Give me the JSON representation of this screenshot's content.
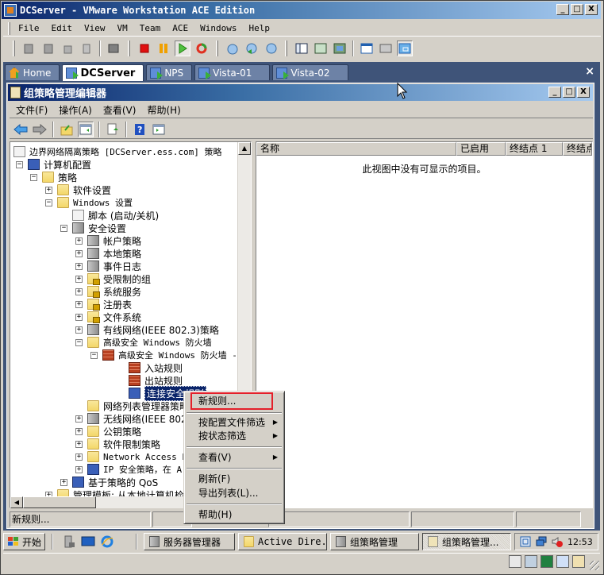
{
  "window": {
    "title": "DCServer - VMware Workstation ACE Edition",
    "controls": {
      "minimize": "_",
      "maximize": "□",
      "close": "X"
    }
  },
  "menubar": [
    "File",
    "Edit",
    "View",
    "VM",
    "Team",
    "ACE",
    "Windows",
    "Help"
  ],
  "toolbar_icons": [
    "snapshot-icon",
    "revert-snapshot-icon",
    "cd-icon",
    "usb-icon",
    "screenshot-icon",
    "stop-icon",
    "pause-icon",
    "play-icon",
    "reset-icon",
    "take-snapshot-icon",
    "revert-icon",
    "snapshot-manager-icon",
    "sidebar-icon",
    "fullscreen-icon",
    "quick-switch-icon",
    "summary-icon",
    "console-icon",
    "appliance-view-icon"
  ],
  "vm_tabs": [
    {
      "label": "Home",
      "active": false
    },
    {
      "label": "DCServer",
      "active": true
    },
    {
      "label": "NPS",
      "active": false
    },
    {
      "label": "Vista-01",
      "active": false
    },
    {
      "label": "Vista-02",
      "active": false
    }
  ],
  "vm_tabs_close": "×",
  "gpm": {
    "title": "组策略管理编辑器",
    "menu": [
      "文件(F)",
      "操作(A)",
      "查看(V)",
      "帮助(H)"
    ],
    "toolbar_icons": [
      "back-icon",
      "forward-icon",
      "up-folder-icon",
      "show-hide-tree-icon",
      "export-list-icon",
      "help-icon",
      "action-pane-icon"
    ]
  },
  "tree": [
    {
      "label": "边界网络隔离策略 [DCServer.ess.com] 策略",
      "icon": "policy-doc",
      "expander": "",
      "level": 0
    },
    {
      "label": "计算机配置",
      "icon": "computer",
      "expander": "−",
      "level": 1
    },
    {
      "label": "策略",
      "icon": "folder",
      "expander": "−",
      "level": 2
    },
    {
      "label": "软件设置",
      "icon": "folder",
      "expander": "+",
      "level": 3
    },
    {
      "label": "Windows 设置",
      "icon": "folder",
      "expander": "−",
      "level": 3
    },
    {
      "label": "脚本 (启动/关机)",
      "icon": "script",
      "expander": "",
      "level": 4
    },
    {
      "label": "安全设置",
      "icon": "security",
      "expander": "−",
      "level": 4
    },
    {
      "label": "帐户策略",
      "icon": "server",
      "expander": "+",
      "level": 5
    },
    {
      "label": "本地策略",
      "icon": "server",
      "expander": "+",
      "level": 5
    },
    {
      "label": "事件日志",
      "icon": "server",
      "expander": "+",
      "level": 5
    },
    {
      "label": "受限制的组",
      "icon": "folder-lock",
      "expander": "+",
      "level": 5
    },
    {
      "label": "系统服务",
      "icon": "folder-lock",
      "expander": "+",
      "level": 5
    },
    {
      "label": "注册表",
      "icon": "folder-lock",
      "expander": "+",
      "level": 5
    },
    {
      "label": "文件系统",
      "icon": "folder-lock",
      "expander": "+",
      "level": 5
    },
    {
      "label": "有线网络(IEEE 802.3)策略",
      "icon": "network",
      "expander": "+",
      "level": 5
    },
    {
      "label": "高级安全 Windows 防火墙",
      "icon": "folder",
      "expander": "−",
      "level": 5
    },
    {
      "label": "高级安全 Windows 防火墙 -",
      "icon": "firewall-globe",
      "expander": "−",
      "level": 6
    },
    {
      "label": "入站规则",
      "icon": "firewall",
      "expander": "",
      "level": 7
    },
    {
      "label": "出站规则",
      "icon": "firewall",
      "expander": "",
      "level": 7
    },
    {
      "label": "连接安全规则",
      "icon": "connection",
      "expander": "",
      "level": 7,
      "selected": true
    },
    {
      "label": "网络列表管理器策略",
      "icon": "folder",
      "expander": "",
      "level": 5
    },
    {
      "label": "无线网络(IEEE 802",
      "icon": "wireless",
      "expander": "+",
      "level": 5
    },
    {
      "label": "公钥策略",
      "icon": "folder",
      "expander": "+",
      "level": 5
    },
    {
      "label": "软件限制策略",
      "icon": "folder",
      "expander": "+",
      "level": 5
    },
    {
      "label": "Network Access Pr",
      "icon": "folder",
      "expander": "+",
      "level": 5
    },
    {
      "label": "IP 安全策略，在 A",
      "icon": "ipsec",
      "expander": "+",
      "level": 5
    },
    {
      "label": "基于策略的 QoS",
      "icon": "qos",
      "expander": "+",
      "level": 4
    },
    {
      "label": "管理模板: 从本地计算机检",
      "icon": "folder",
      "expander": "+",
      "level": 3
    }
  ],
  "list": {
    "columns": [
      "名称",
      "已启用",
      "终结点 1",
      "终结点"
    ],
    "empty_message": "此视图中没有可显示的项目。"
  },
  "context_menu": {
    "items": [
      {
        "label": "新规则...",
        "submenu": false,
        "highlighted": true
      },
      {
        "label": "按配置文件筛选",
        "submenu": true
      },
      {
        "label": "按状态筛选",
        "submenu": true
      },
      {
        "label": "查看(V)",
        "submenu": true
      },
      {
        "label": "刷新(F)",
        "submenu": false
      },
      {
        "label": "导出列表(L)...",
        "submenu": false
      },
      {
        "label": "帮助(H)",
        "submenu": false
      }
    ],
    "arrow": "▶"
  },
  "status_bar": {
    "text": "新规则..."
  },
  "taskbar": {
    "start": "开始",
    "quick_launch": [
      "server-manager-icon",
      "desktop-icon",
      "ie-icon"
    ],
    "buttons": [
      {
        "label": "服务器管理器",
        "active": false
      },
      {
        "label": "Active Dire...",
        "active": false
      },
      {
        "label": "组策略管理",
        "active": false
      },
      {
        "label": "组策略管理...",
        "active": true
      }
    ],
    "clock": "12:53"
  },
  "devices": [
    "hdd-icon",
    "cdrom-icon",
    "network-adapter-icon",
    "sound-icon",
    "message-icon"
  ]
}
